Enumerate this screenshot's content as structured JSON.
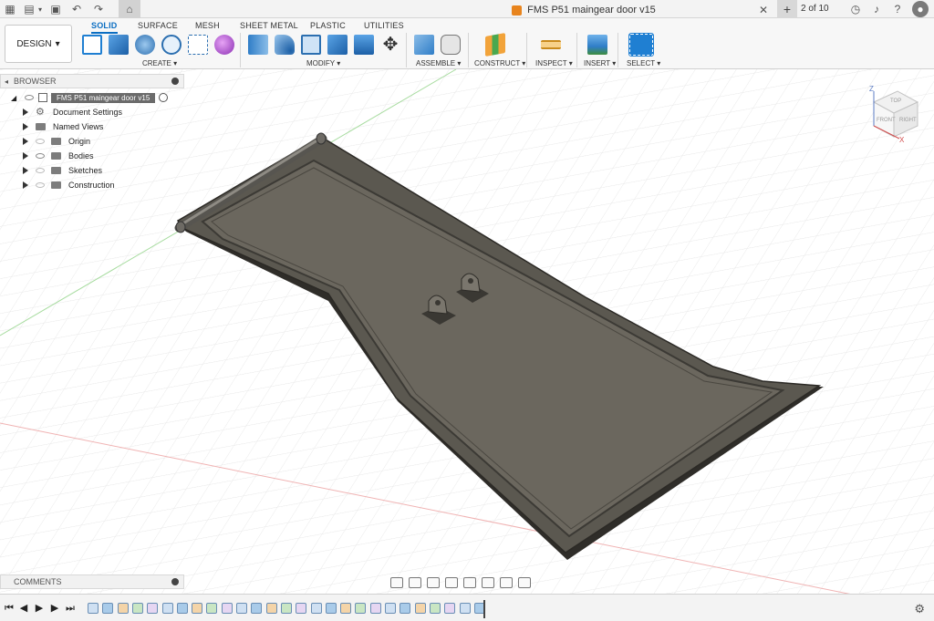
{
  "window": {
    "doc_title": "FMS P51 maingear door v15",
    "page_indicator": "2 of 10"
  },
  "toolbar": {
    "workspace_label": "DESIGN",
    "tabs": [
      {
        "label": "SOLID",
        "active": true
      },
      {
        "label": "SURFACE",
        "active": false
      },
      {
        "label": "MESH",
        "active": false
      },
      {
        "label": "SHEET METAL",
        "active": false
      },
      {
        "label": "PLASTIC",
        "active": false
      },
      {
        "label": "UTILITIES",
        "active": false
      }
    ],
    "groups": [
      "CREATE",
      "MODIFY",
      "ASSEMBLE",
      "CONSTRUCT",
      "INSPECT",
      "INSERT",
      "SELECT"
    ]
  },
  "browser": {
    "header": "BROWSER",
    "root": "FMS P51 maingear door v15",
    "items": [
      "Document Settings",
      "Named Views",
      "Origin",
      "Bodies",
      "Sketches",
      "Construction"
    ]
  },
  "comments": {
    "header": "COMMENTS"
  },
  "viewcube": {
    "top": "TOP",
    "front": "FRONT",
    "right": "RIGHT",
    "axis_z": "Z",
    "axis_x": "X"
  },
  "colors": {
    "accent": "#0b6ec2",
    "body": "#6b675e",
    "body_dark": "#3d3a34",
    "grid": "#e0e0e0"
  },
  "icons": [
    "home-icon",
    "undo-icon",
    "redo-icon",
    "save-icon",
    "file-icon",
    "grid-icon",
    "close-icon",
    "plus-icon",
    "clock-icon",
    "bell-icon",
    "help-icon",
    "avatar-icon"
  ]
}
